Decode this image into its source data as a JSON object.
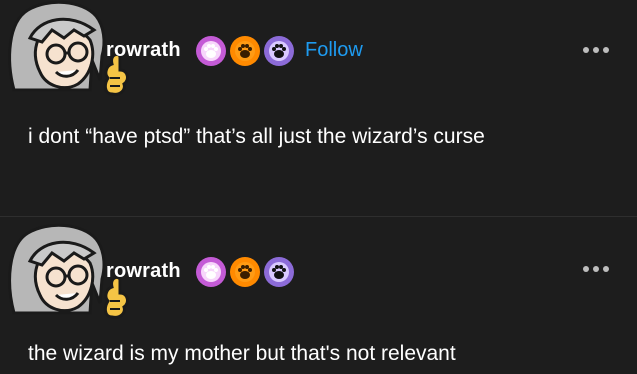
{
  "posts": [
    {
      "username": "rowrath",
      "follow_label": "Follow",
      "text": "i dont “have ptsd” that’s all just the wizard’s curse",
      "badges": [
        "pink-paw-badge",
        "orange-paw-badge",
        "purple-paw-badge"
      ]
    },
    {
      "username": "rowrath",
      "text": "the wizard is my mother but that's not relevant",
      "badges": [
        "pink-paw-badge",
        "orange-paw-badge",
        "purple-paw-badge"
      ]
    }
  ],
  "colors": {
    "background": "#1d1d1d",
    "follow": "#1e9bf0",
    "badge_pink": "#c45bd6",
    "badge_orange": "#ff8a00",
    "badge_purple": "#8c6bd8"
  }
}
